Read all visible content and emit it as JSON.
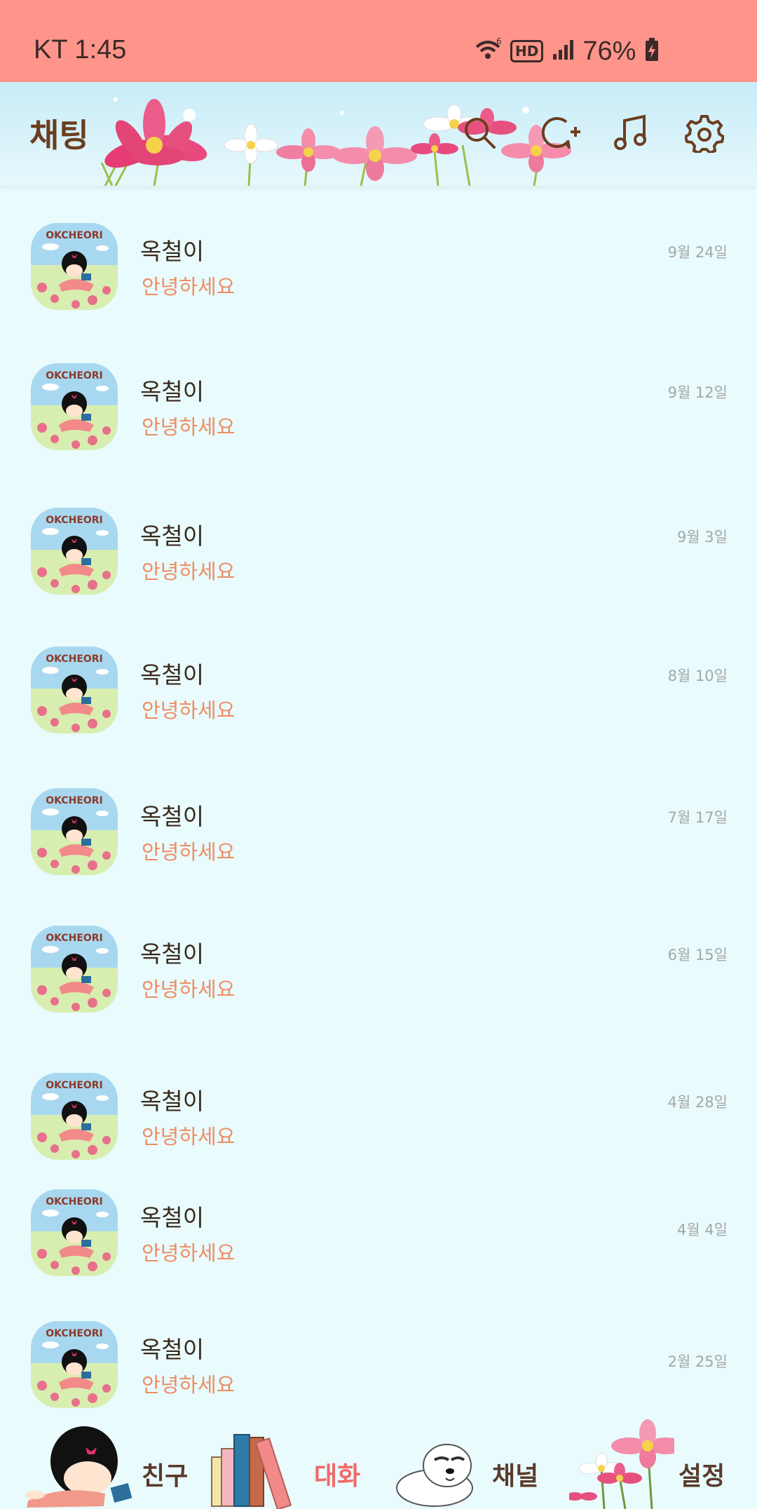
{
  "status_bar": {
    "carrier_time": "KT 1:45",
    "battery": "76%",
    "hd_label": "HD"
  },
  "header": {
    "title": "채팅",
    "icons": [
      "search-icon",
      "new-chat-icon",
      "music-icon",
      "settings-icon"
    ]
  },
  "chats": [
    {
      "name": "옥철이",
      "message": "안녕하세요",
      "date": "9월 24일",
      "avatar_label": "OKCHEORI"
    },
    {
      "name": "옥철이",
      "message": "안녕하세요",
      "date": "9월 12일",
      "avatar_label": "OKCHEORI"
    },
    {
      "name": "옥철이",
      "message": "안녕하세요",
      "date": "9월 3일",
      "avatar_label": "OKCHEORI"
    },
    {
      "name": "옥철이",
      "message": "안녕하세요",
      "date": "8월 10일",
      "avatar_label": "OKCHEORI"
    },
    {
      "name": "옥철이",
      "message": "안녕하세요",
      "date": "7월 17일",
      "avatar_label": "OKCHEORI"
    },
    {
      "name": "옥철이",
      "message": "안녕하세요",
      "date": "6월 15일",
      "avatar_label": "OKCHEORI"
    },
    {
      "name": "옥철이",
      "message": "안녕하세요",
      "date": "4월 28일",
      "avatar_label": "OKCHEORI"
    },
    {
      "name": "옥철이",
      "message": "안녕하세요",
      "date": "4월 4일",
      "avatar_label": "OKCHEORI"
    },
    {
      "name": "옥철이",
      "message": "안녕하세요",
      "date": "2월 25일",
      "avatar_label": "OKCHEORI"
    }
  ],
  "bottom_nav": {
    "items": [
      {
        "label": "친구",
        "active": false
      },
      {
        "label": "대화",
        "active": true
      },
      {
        "label": "채널",
        "active": false
      },
      {
        "label": "설정",
        "active": false
      }
    ]
  },
  "colors": {
    "status_bar": "#FF958A",
    "background": "#E9FBFC",
    "message_text": "#EE8D63",
    "active_tab": "#F06A6A",
    "title": "#6B3E1F"
  }
}
